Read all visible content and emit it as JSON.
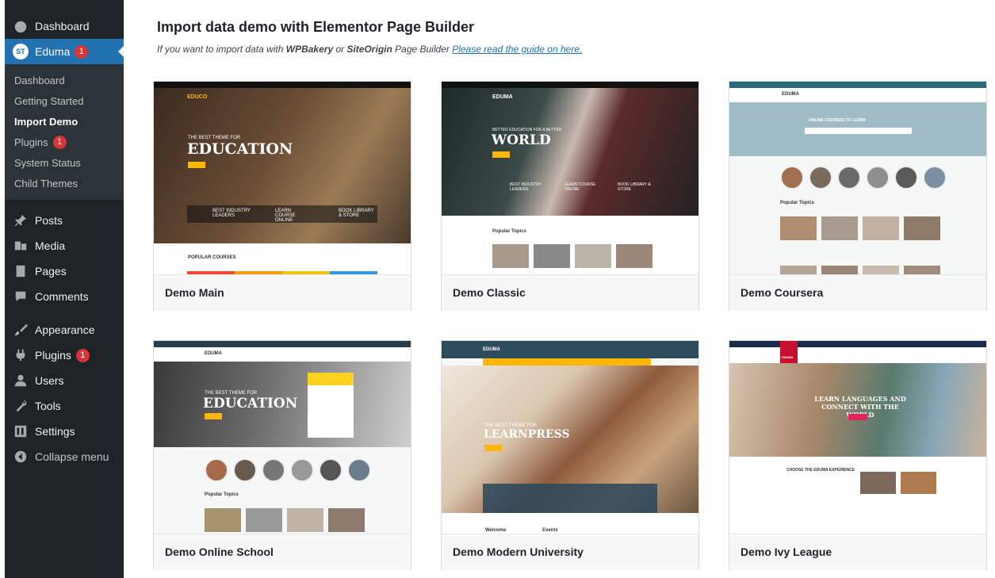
{
  "sidebar": {
    "dashboard": "Dashboard",
    "eduma": {
      "label": "Eduma",
      "badge": "1",
      "logo_text": "ST"
    },
    "submenu": [
      "Dashboard",
      "Getting Started",
      "Import Demo",
      "Plugins",
      "System Status",
      "Child Themes"
    ],
    "submenu_plugins_badge": "1",
    "posts": "Posts",
    "media": "Media",
    "pages": "Pages",
    "comments": "Comments",
    "appearance": "Appearance",
    "plugins": {
      "label": "Plugins",
      "badge": "1"
    },
    "users": "Users",
    "tools": "Tools",
    "settings": "Settings",
    "collapse": "Collapse menu"
  },
  "header": {
    "title": "Import data demo with Elementor Page Builder",
    "subtitle_prefix": "If you want to import data with ",
    "subtitle_b1": "WPBakery",
    "subtitle_mid": " or ",
    "subtitle_b2": "SiteOrigin",
    "subtitle_after": " Page Builder ",
    "subtitle_link": "Please read the guide on here."
  },
  "demos": [
    {
      "title": "Demo Main",
      "hero": "EDUCATION",
      "logo": "EDUCO",
      "tag": "THE BEST THEME FOR",
      "section": "POPULAR COURSES",
      "features": [
        "BEST INDUSTRY LEADERS",
        "LEARN COURSE ONLINE",
        "BOOK LIBRARY & STORE"
      ]
    },
    {
      "title": "Demo Classic",
      "hero": "WORLD",
      "logo": "EDUMA",
      "tag": "BETTER EDUCATION FOR A BETTER",
      "section": "Popular Topics",
      "features": [
        "BEST INDUSTRY LEADERS",
        "LEARN COURSE ONLINE",
        "BOOK LIBRARY & STORE"
      ]
    },
    {
      "title": "Demo Coursera",
      "hero": "ONLINE COURSES TO LEARN",
      "logo": "EDUMA",
      "tag": "",
      "section": "Popular Topics",
      "features": []
    },
    {
      "title": "Demo Online School",
      "hero": "EDUCATION",
      "logo": "EDUMA",
      "tag": "THE BEST THEME FOR",
      "section": "Popular Topics",
      "features": []
    },
    {
      "title": "Demo Modern University",
      "hero": "LEARNPRESS",
      "logo": "EDUMA",
      "tag": "THE BEST THEME FOR",
      "section": "Welcome",
      "section2": "Events",
      "features": []
    },
    {
      "title": "Demo Ivy League",
      "hero": "LEARN LANGUAGES AND CONNECT WITH THE WORLD",
      "logo": "EDUMA",
      "tag": "",
      "section": "CHOOSE THE EDUMA EXPERIENCE",
      "features": []
    }
  ],
  "colors": {
    "sidebar_bg": "#1d2327",
    "active_bg": "#2271b1",
    "badge": "#d63638",
    "accent_yellow": "#ffb606"
  }
}
